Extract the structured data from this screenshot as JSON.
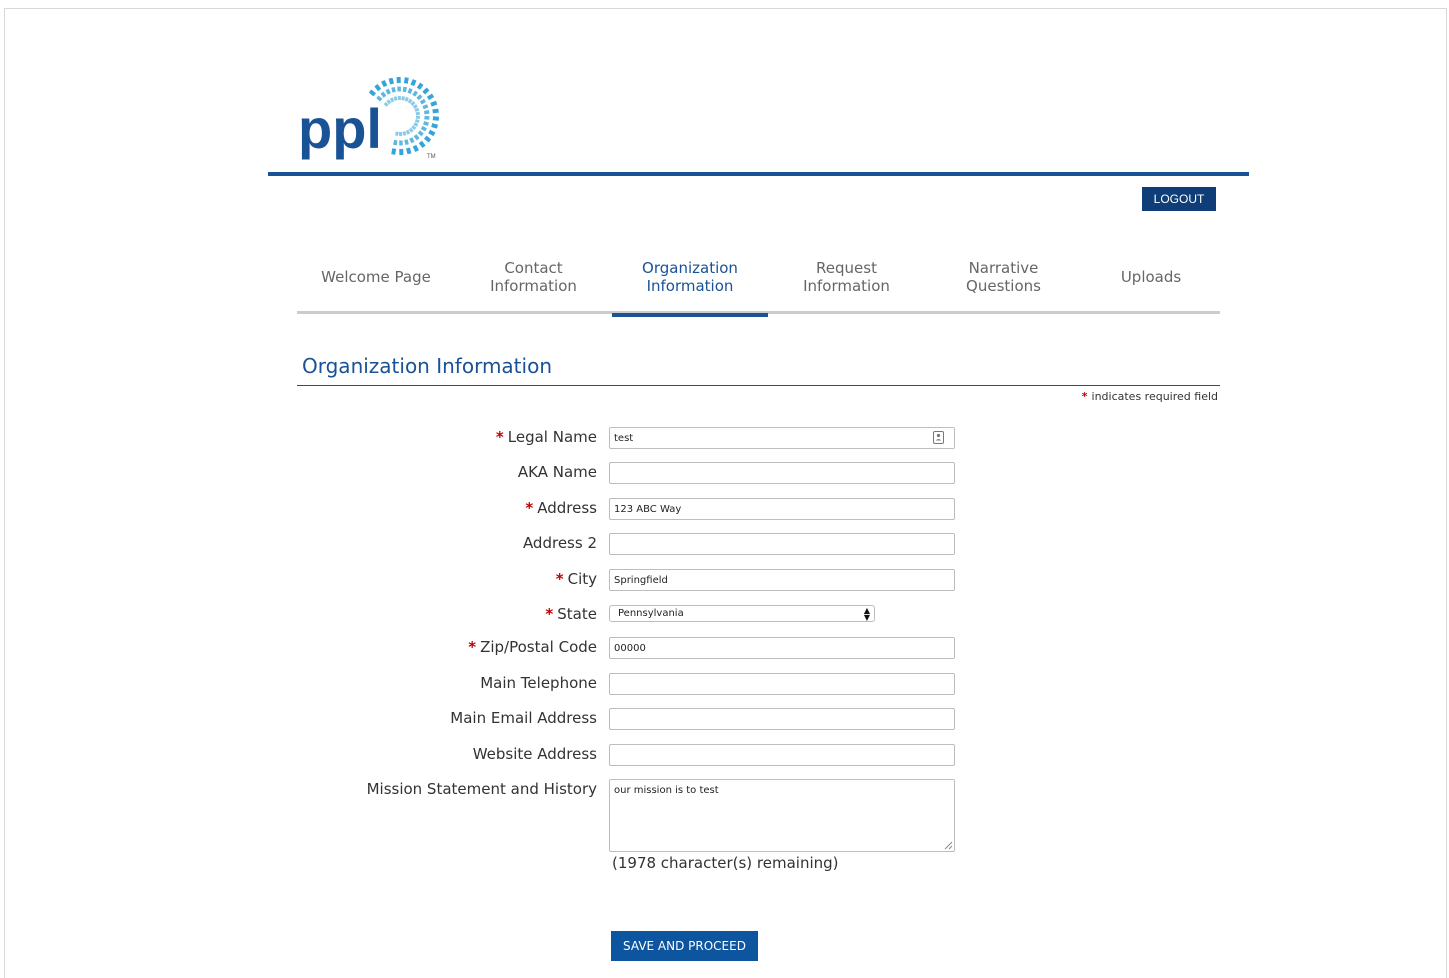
{
  "brand": {
    "logo_text": "ppl",
    "trademark": "TM",
    "primary_color": "#1a5296",
    "burst_color": "#2a9fd6"
  },
  "header": {
    "logout_label": "LOGOUT"
  },
  "tabs": [
    {
      "label": "Welcome Page",
      "active": false
    },
    {
      "label": "Contact\nInformation",
      "active": false
    },
    {
      "label": "Organization\nInformation",
      "active": true
    },
    {
      "label": "Request\nInformation",
      "active": false
    },
    {
      "label": "Narrative\nQuestions",
      "active": false
    },
    {
      "label": "Uploads",
      "active": false
    }
  ],
  "section": {
    "title": "Organization Information",
    "required_marker": "*",
    "required_note": "indicates required field"
  },
  "form": {
    "legal_name": {
      "label": "Legal Name",
      "value": "test"
    },
    "aka_name": {
      "label": "AKA Name",
      "value": ""
    },
    "address": {
      "label": "Address",
      "value": "123 ABC Way"
    },
    "address2": {
      "label": "Address 2",
      "value": ""
    },
    "city": {
      "label": "City",
      "value": "Springfield"
    },
    "state": {
      "label": "State",
      "value": "Pennsylvania"
    },
    "zip": {
      "label": "Zip/Postal Code",
      "value": "00000"
    },
    "telephone": {
      "label": "Main Telephone",
      "value": ""
    },
    "email": {
      "label": "Main Email Address",
      "value": ""
    },
    "website": {
      "label": "Website Address",
      "value": ""
    },
    "mission": {
      "label": "Mission Statement and History",
      "value": "our mission is to test"
    },
    "remaining": "(1978 character(s) remaining)",
    "save_label": "SAVE AND PROCEED"
  }
}
